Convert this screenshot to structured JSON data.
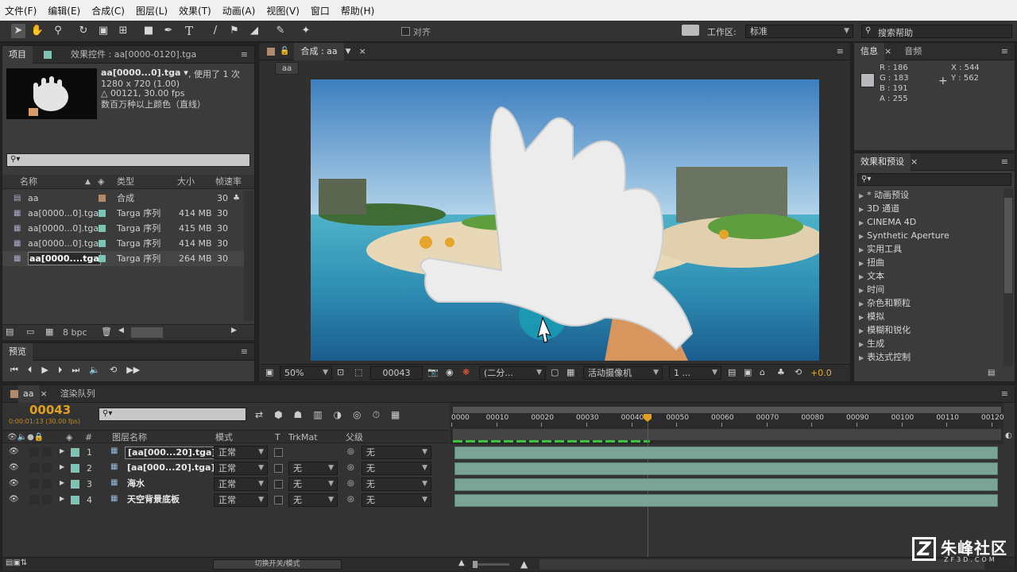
{
  "menubar": {
    "items": [
      "文件(F)",
      "编辑(E)",
      "合成(C)",
      "图层(L)",
      "效果(T)",
      "动画(A)",
      "视图(V)",
      "窗口",
      "帮助(H)"
    ]
  },
  "toolbar": {
    "align_label": "对齐",
    "workspace_label": "工作区:",
    "workspace_value": "标准",
    "search_placeholder": "搜索帮助"
  },
  "project_panel": {
    "tab_label": "项目",
    "effects_tab": "效果控件 : aa[0000-0120].tga",
    "asset_name": "aa[0000...0].tga ▾",
    "asset_usage": ", 使用了 1 次",
    "asset_dims": "1280 x 720 (1.00)",
    "asset_frames": "△ 00121, 30.00 fps",
    "asset_color": "数百万种以上颜色（直线）",
    "columns": [
      "名称",
      "类型",
      "大小",
      "帧速率"
    ],
    "items": [
      {
        "name": "aa",
        "type": "合成",
        "size": "",
        "fps": "30",
        "color": "#b08a6a"
      },
      {
        "name": "aa[0000...0].tga",
        "type": "Targa 序列",
        "size": "414 MB",
        "fps": "30",
        "color": "#7fc3b4"
      },
      {
        "name": "aa[0000...0].tga",
        "type": "Targa 序列",
        "size": "415 MB",
        "fps": "30",
        "color": "#7fc3b4"
      },
      {
        "name": "aa[0000...0].tga",
        "type": "Targa 序列",
        "size": "414 MB",
        "fps": "30",
        "color": "#7fc3b4"
      },
      {
        "name": "aa[0000....tga",
        "type": "Targa 序列",
        "size": "264 MB",
        "fps": "30",
        "color": "#7fc3b4"
      }
    ],
    "bpc": "8 bpc"
  },
  "preview_panel": {
    "tab_label": "预览"
  },
  "composition_panel": {
    "tab_label": "合成 : aa",
    "breadcrumb": "aa",
    "zoom": "50%",
    "timecode": "00043",
    "resolution": "(二分...",
    "camera": "活动摄像机",
    "views": "1 ...",
    "exposure": "+0.0"
  },
  "info_panel": {
    "tab_info": "信息",
    "tab_audio": "音频",
    "r": "R : 186",
    "g": "G : 183",
    "b": "B : 191",
    "a": "A : 255",
    "x": "X : 544",
    "y": "Y : 562"
  },
  "effects_panel": {
    "tab_label": "效果和预设",
    "items": [
      "* 动画预设",
      "3D 通道",
      "CINEMA 4D",
      "Synthetic Aperture",
      "实用工具",
      "扭曲",
      "文本",
      "时间",
      "杂色和颗粒",
      "模拟",
      "模糊和锐化",
      "生成",
      "表达式控制"
    ]
  },
  "timeline": {
    "tab_comp": "aa",
    "tab_render": "渲染队列",
    "timecode": "00043",
    "timecode_sub": "0:00:01:13 (30.00 fps)",
    "columns": {
      "layer_name": "图层名称",
      "mode": "模式",
      "t": "T",
      "trkmat": "TrkMat",
      "parent": "父级"
    },
    "layers": [
      {
        "num": "1",
        "name": "[aa[000...20].tga]",
        "mode": "正常",
        "trkmat": "",
        "parent": "无"
      },
      {
        "num": "2",
        "name": "[aa[000...20].tga]",
        "mode": "正常",
        "trkmat": "无",
        "parent": "无"
      },
      {
        "num": "3",
        "name": "海水",
        "mode": "正常",
        "trkmat": "无",
        "parent": "无"
      },
      {
        "num": "4",
        "name": "天空背景底板",
        "mode": "正常",
        "trkmat": "无",
        "parent": "无"
      }
    ],
    "ruler_ticks": [
      "0000",
      "00010",
      "00020",
      "00030",
      "00040",
      "00050",
      "00060",
      "00070",
      "00080",
      "00090",
      "00100",
      "00110",
      "00120"
    ],
    "toggle_label": "切换开关/模式"
  },
  "watermark": {
    "brand": "朱峰社区",
    "url": "ZF3D.COM"
  }
}
